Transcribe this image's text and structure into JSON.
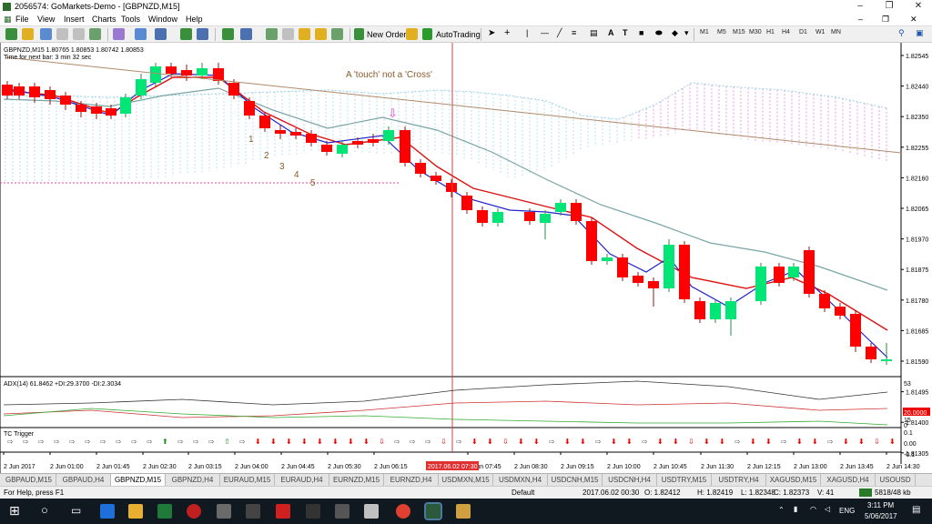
{
  "window": {
    "title": "2056574: GoMarkets-Demo - [GBPNZD,M15]"
  },
  "menu": [
    "File",
    "View",
    "Insert",
    "Charts",
    "Tools",
    "Window",
    "Help"
  ],
  "toolbar": {
    "new_order": "New Order",
    "autotrading": "AutoTrading",
    "timeframes": [
      "M1",
      "M5",
      "M15",
      "M30",
      "H1",
      "H4",
      "D1",
      "W1",
      "MN"
    ]
  },
  "chart": {
    "symbol_info": "GBPNZD,M15  1.80765 1.80853 1.80742 1.80853",
    "timer": "Time for next bar: 3 min 32 sec",
    "annotation": "A 'touch' not a 'Cross'",
    "wave_labels": [
      "1",
      "2",
      "3",
      "4",
      "5"
    ],
    "price_labels": [
      "1.82545",
      "1.82440",
      "1.82350",
      "1.82255",
      "1.82160",
      "1.82065",
      "1.81970",
      "1.81875",
      "1.81780",
      "1.81685",
      "1.81590",
      "1.81495",
      "1.81400",
      "1.81305"
    ],
    "time_labels": [
      "2 Jun 2017",
      "2 Jun 01:00",
      "2 Jun 01:45",
      "2 Jun 02:30",
      "2 Jun 03:15",
      "2 Jun 04:00",
      "2 Jun 04:45",
      "2 Jun 05:30",
      "2 Jun 06:15",
      "2 Jun 07:45",
      "2 Jun 08:30",
      "2 Jun 09:15",
      "2 Jun 10:00",
      "2 Jun 10:45",
      "2 Jun 11:30",
      "2 Jun 12:15",
      "2 Jun 13:00",
      "2 Jun 13:45",
      "2 Jun 14:30"
    ],
    "cursor_time": "2017.06.02 07:30",
    "adx_label": "ADX(14) 61.8462 +DI:29.3700 -DI:2.3034",
    "adx_levels": [
      "53",
      "20.0000",
      "15",
      "0"
    ],
    "tc_label": "TC Trigger",
    "tc_levels": [
      "0.1",
      "0.00",
      "-0.1"
    ]
  },
  "tabs": [
    "GBPAUD,M15",
    "GBPAUD,H4",
    "GBPNZD,M15",
    "GBPNZD,H4",
    "EURAUD,M15",
    "EURAUD,H4",
    "EURNZD,M15",
    "EURNZD,H4",
    "USDMXN,M15",
    "USDMXN,H4",
    "USDCNH,M15",
    "USDCNH,H4",
    "USDTRY,M15",
    "USDTRY,H4",
    "XAGUSD,M15",
    "XAGUSD,H4",
    "USOUSD"
  ],
  "active_tab": "GBPNZD,M15",
  "status": {
    "help": "For Help, press F1",
    "profile": "Default",
    "datetime": "2017.06.02 00:30",
    "open": "O: 1.82412",
    "high": "H: 1.82419",
    "low": "L: 1.82348",
    "close": "C: 1.82373",
    "volume": "V: 41",
    "traffic": "5818/48 kb"
  },
  "taskbar": {
    "time": "3:11 PM",
    "date": "5/06/2017",
    "lang": "ENG"
  },
  "colors": {
    "bull": "#00e676",
    "bear": "#ff0000",
    "ema_red": "#dd1111",
    "ema_blue": "#2222cc",
    "sma_teal": "#7aa5a5",
    "trendline": "#b08a6a"
  }
}
